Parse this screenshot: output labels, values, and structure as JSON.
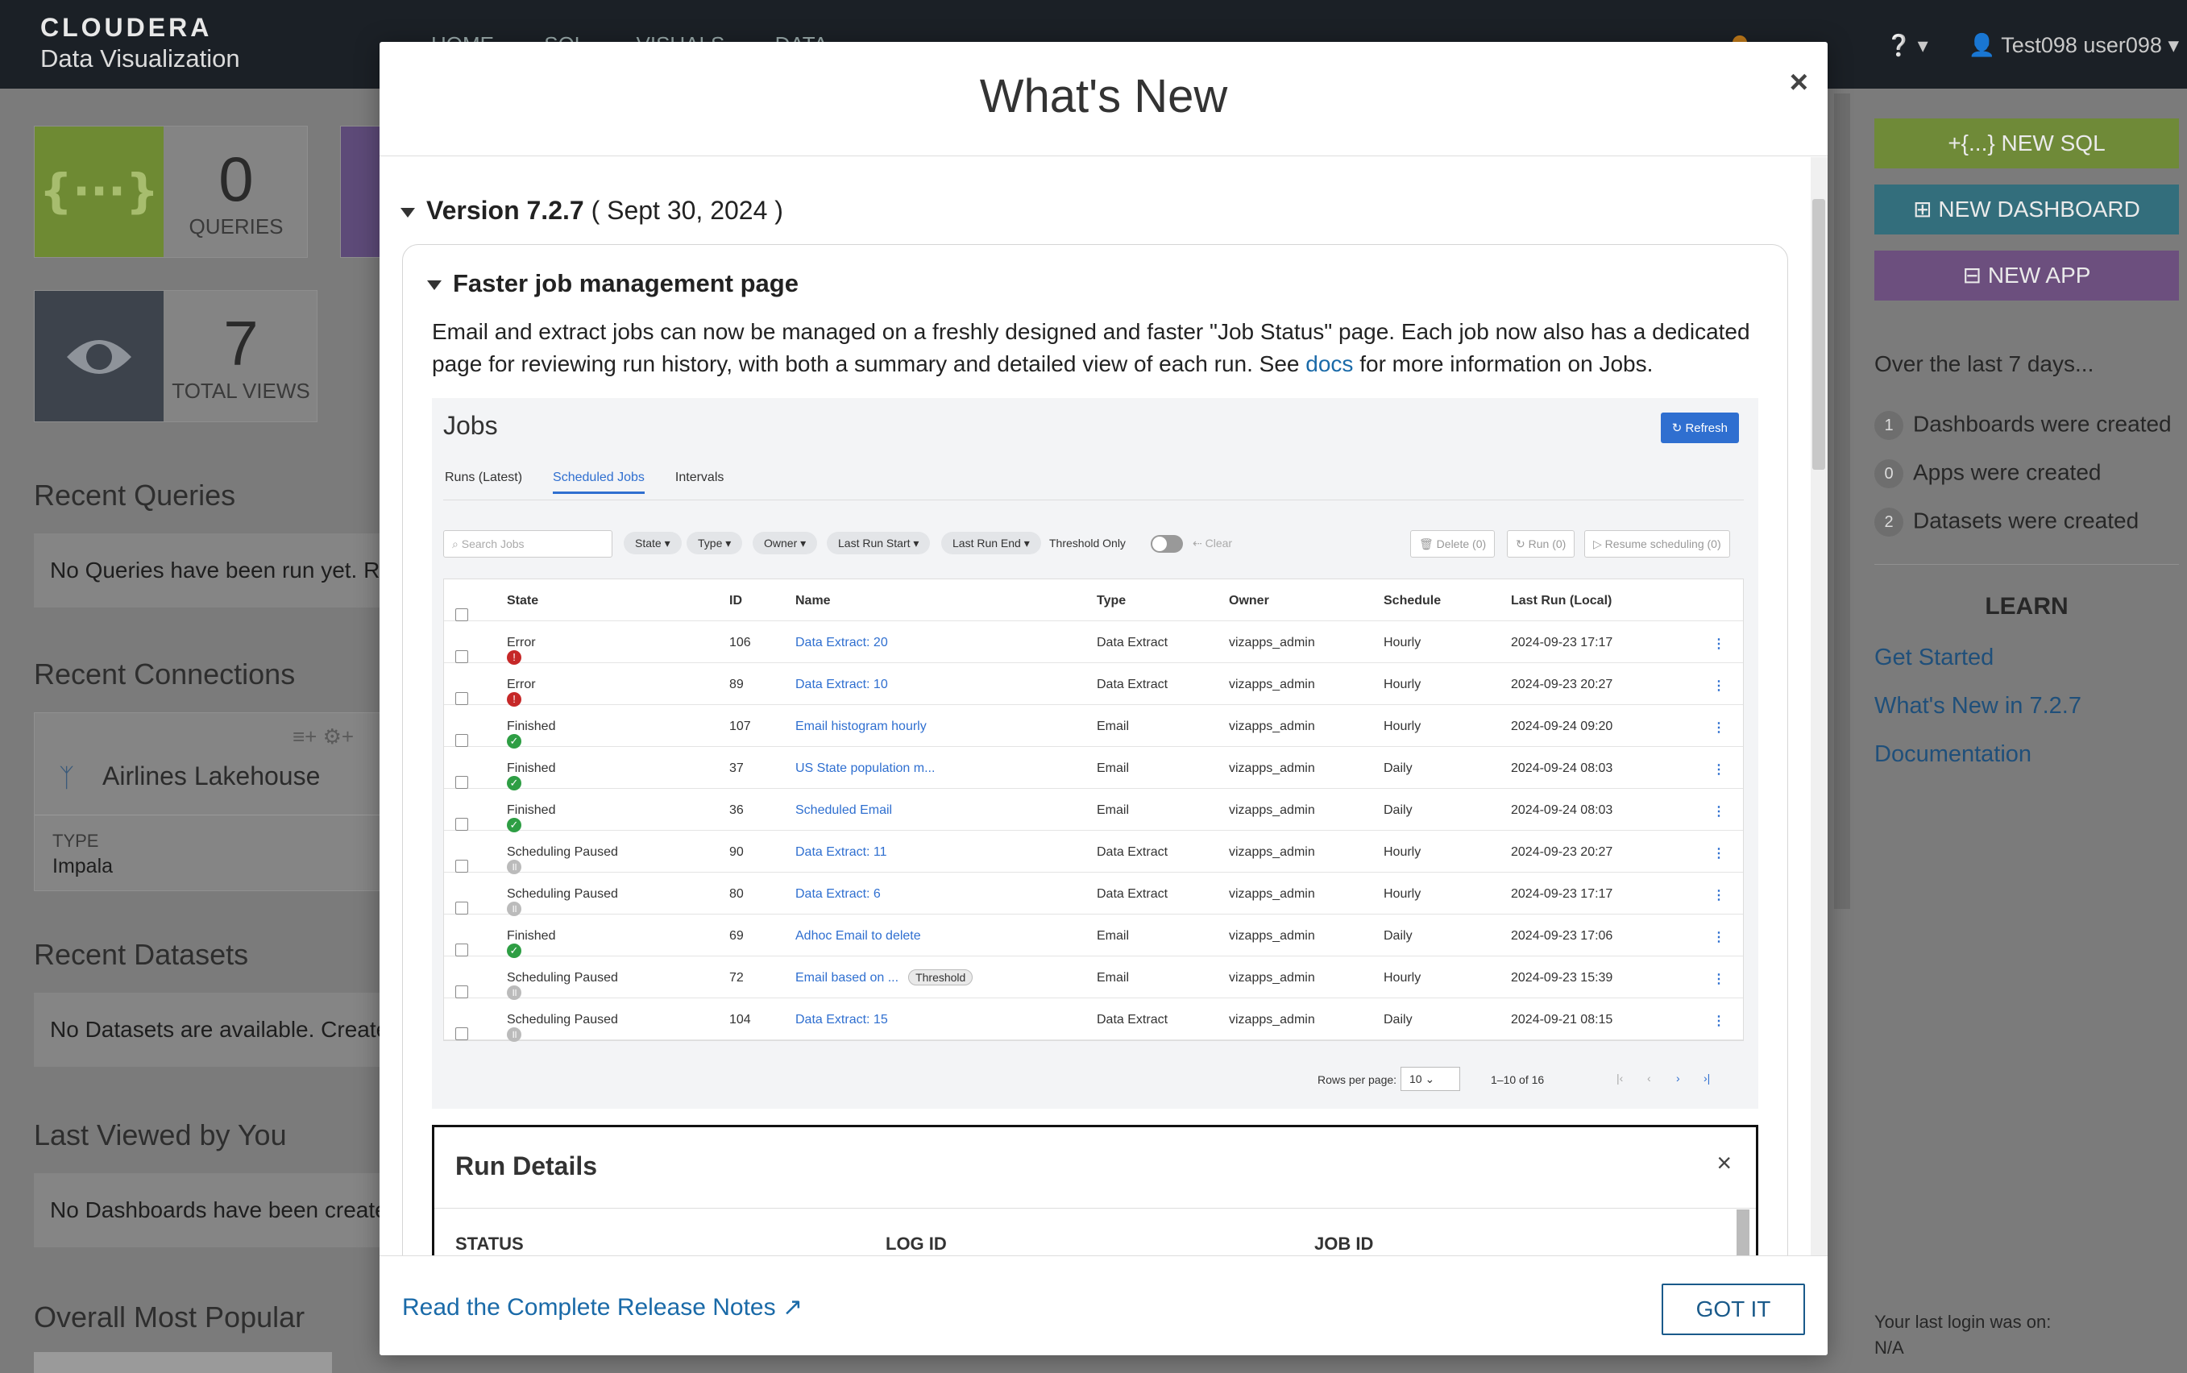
{
  "nav": {
    "brand_line1": "CLOUDERA",
    "brand_line2": "Data Visualization",
    "links": [
      "HOME",
      "SQL",
      "VISUALS",
      "DATA"
    ],
    "user": "Test098 user098"
  },
  "dashboard": {
    "queries_count": "0",
    "queries_label": "QUERIES",
    "views_count": "7",
    "views_label": "TOTAL VIEWS",
    "recent_queries_title": "Recent Queries",
    "recent_queries_msg": "No Queries have been run yet. Ru",
    "recent_connections_title": "Recent Connections",
    "connection_name": "Airlines Lakehouse",
    "connection_type_label": "TYPE",
    "connection_type": "Impala",
    "recent_datasets_title": "Recent Datasets",
    "recent_datasets_msg": "No Datasets are available. Create",
    "last_viewed_title": "Last Viewed by You",
    "last_viewed_msg": "No Dashboards have been create",
    "most_popular_title": "Overall Most Popular"
  },
  "sidebar": {
    "new_sql": "NEW SQL",
    "new_dashboard": "NEW DASHBOARD",
    "new_app": "NEW APP",
    "last7": "Over the last 7 days...",
    "stats": [
      {
        "count": "1",
        "text": "Dashboards were created"
      },
      {
        "count": "0",
        "text": "Apps were created"
      },
      {
        "count": "2",
        "text": "Datasets were created"
      }
    ],
    "learn_title": "LEARN",
    "learn_links": [
      "Get Started",
      "What's New in 7.2.7",
      "Documentation"
    ],
    "last_login_label": "Your last login was on:",
    "last_login_value": "N/A"
  },
  "modal": {
    "title": "What's New",
    "close_label": "×",
    "version": "Version 7.2.7",
    "version_date": "( Sept 30, 2024 )",
    "feature_title": "Faster job management page",
    "feature_text_1": "Email and extract jobs can now be managed on a freshly designed and faster \"Job Status\" page. Each job now also has a dedicated page for reviewing run history, with both a summary and detailed view of each run. See ",
    "feature_link": "docs",
    "feature_text_2": " for more information on Jobs.",
    "release_notes": "Read the Complete Release Notes",
    "got_it": "GOT IT"
  },
  "jobs": {
    "title": "Jobs",
    "refresh": "Refresh",
    "tabs": [
      "Runs (Latest)",
      "Scheduled Jobs",
      "Intervals"
    ],
    "search_placeholder": "Search Jobs",
    "filters": [
      "State",
      "Type",
      "Owner",
      "Last Run Start",
      "Last Run End"
    ],
    "threshold_label": "Threshold Only",
    "clear": "Clear",
    "delete": "Delete (0)",
    "run": "Run (0)",
    "resume": "Resume scheduling (0)",
    "columns": [
      "State",
      "ID",
      "Name",
      "Type",
      "Owner",
      "Schedule",
      "Last Run (Local)"
    ],
    "rows": [
      {
        "state": "Error",
        "kind": "err",
        "id": "106",
        "name": "Data Extract: 20",
        "type": "Data Extract",
        "owner": "vizapps_admin",
        "schedule": "Hourly",
        "last": "2024-09-23 17:17",
        "tag": ""
      },
      {
        "state": "Error",
        "kind": "err",
        "id": "89",
        "name": "Data Extract: 10",
        "type": "Data Extract",
        "owner": "vizapps_admin",
        "schedule": "Hourly",
        "last": "2024-09-23 20:27",
        "tag": ""
      },
      {
        "state": "Finished",
        "kind": "fin",
        "id": "107",
        "name": "Email histogram hourly",
        "type": "Email",
        "owner": "vizapps_admin",
        "schedule": "Hourly",
        "last": "2024-09-24 09:20",
        "tag": ""
      },
      {
        "state": "Finished",
        "kind": "fin",
        "id": "37",
        "name": "US State population m...",
        "type": "Email",
        "owner": "vizapps_admin",
        "schedule": "Daily",
        "last": "2024-09-24 08:03",
        "tag": ""
      },
      {
        "state": "Finished",
        "kind": "fin",
        "id": "36",
        "name": "Scheduled Email",
        "type": "Email",
        "owner": "vizapps_admin",
        "schedule": "Daily",
        "last": "2024-09-24 08:03",
        "tag": ""
      },
      {
        "state": "Scheduling Paused",
        "kind": "pau",
        "id": "90",
        "name": "Data Extract: 11",
        "type": "Data Extract",
        "owner": "vizapps_admin",
        "schedule": "Hourly",
        "last": "2024-09-23 20:27",
        "tag": ""
      },
      {
        "state": "Scheduling Paused",
        "kind": "pau",
        "id": "80",
        "name": "Data Extract: 6",
        "type": "Data Extract",
        "owner": "vizapps_admin",
        "schedule": "Hourly",
        "last": "2024-09-23 17:17",
        "tag": ""
      },
      {
        "state": "Finished",
        "kind": "fin",
        "id": "69",
        "name": "Adhoc Email to delete",
        "type": "Email",
        "owner": "vizapps_admin",
        "schedule": "Daily",
        "last": "2024-09-23 17:06",
        "tag": ""
      },
      {
        "state": "Scheduling Paused",
        "kind": "pau",
        "id": "72",
        "name": "Email based on ...",
        "type": "Email",
        "owner": "vizapps_admin",
        "schedule": "Hourly",
        "last": "2024-09-23 15:39",
        "tag": "Threshold"
      },
      {
        "state": "Scheduling Paused",
        "kind": "pau",
        "id": "104",
        "name": "Data Extract: 15",
        "type": "Data Extract",
        "owner": "vizapps_admin",
        "schedule": "Daily",
        "last": "2024-09-21 08:15",
        "tag": ""
      }
    ],
    "rows_per_page_label": "Rows per page:",
    "rows_per_page": "10",
    "range": "1–10 of 16"
  },
  "run_details": {
    "title": "Run Details",
    "columns": [
      "STATUS",
      "LOG ID",
      "JOB ID"
    ]
  },
  "colors": {
    "queries_tile": "#7e9b3a",
    "views_tile": "#3a4350",
    "new_sql": "#7f9a3e",
    "new_dashboard": "#3b7e8e",
    "new_app": "#7b5b8e",
    "link": "#1a6aa8"
  }
}
